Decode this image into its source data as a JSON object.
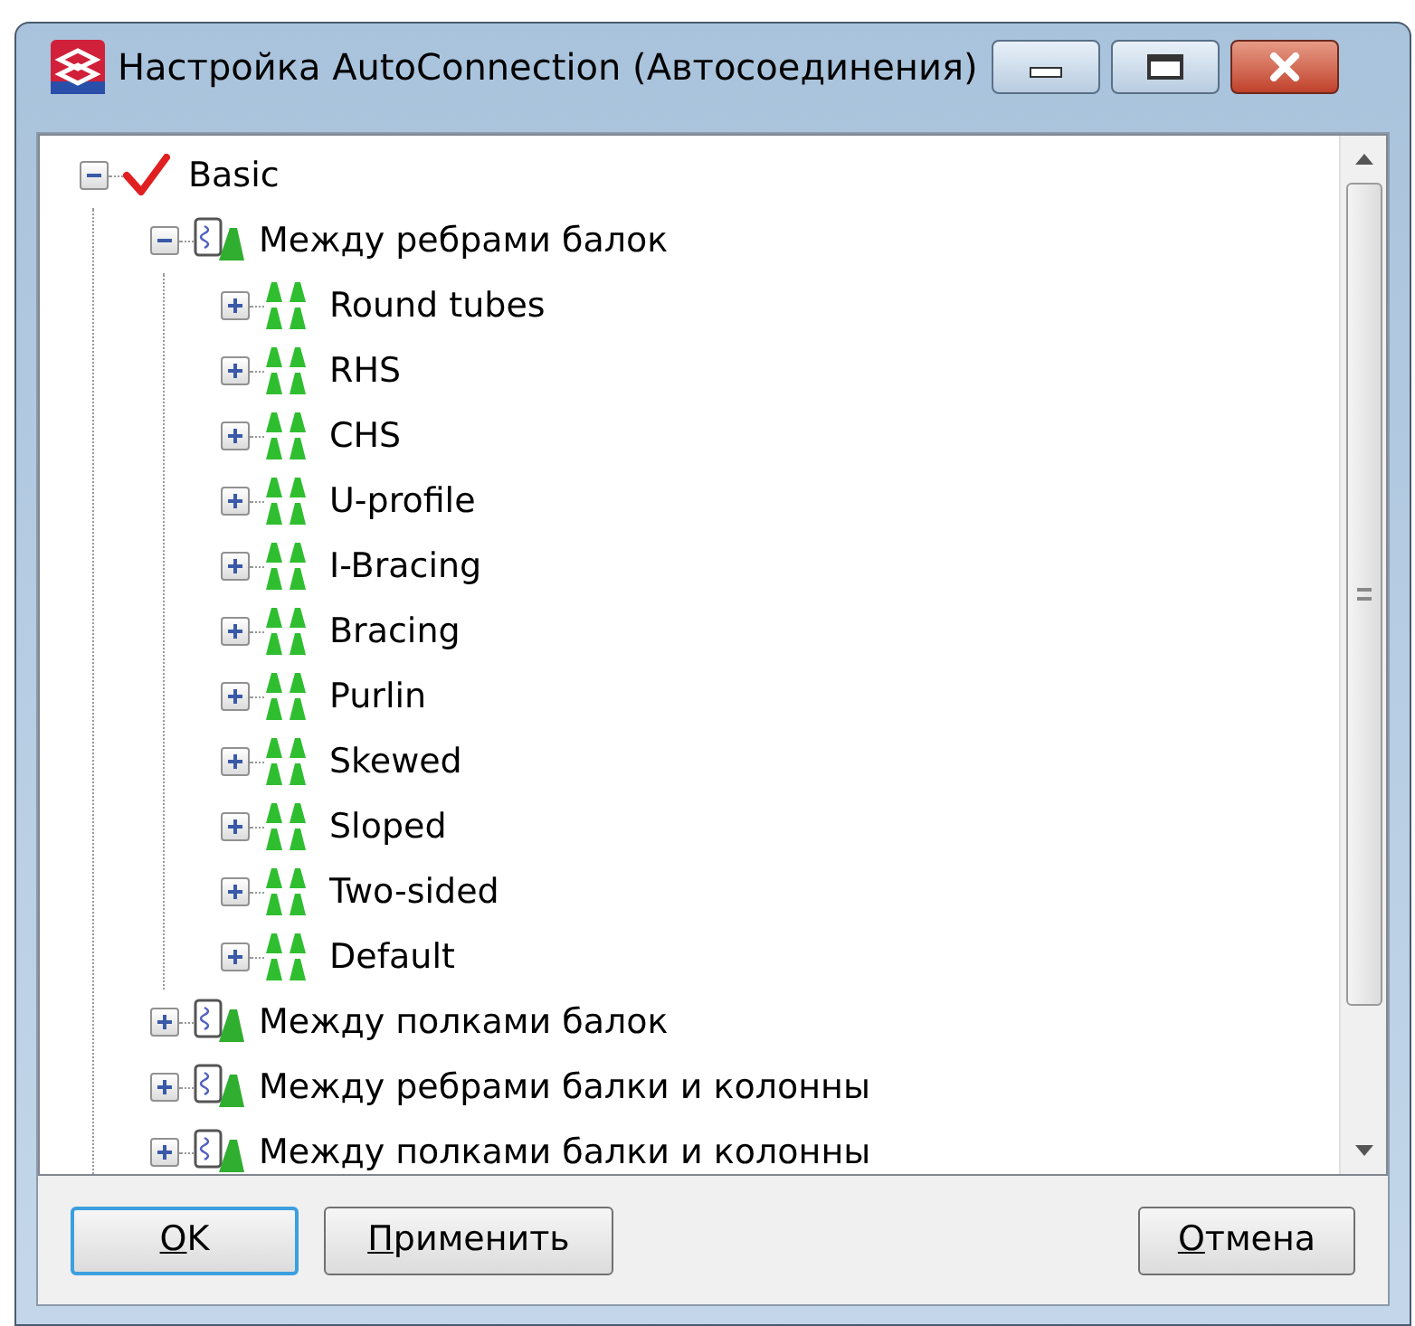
{
  "window": {
    "title": "Настройка AutoConnection (Автосоединения)"
  },
  "tree": [
    {
      "label": "Basic",
      "kind": "check",
      "expanded": true,
      "children": [
        {
          "label": "Между ребрами балок",
          "kind": "group",
          "expanded": true,
          "children": [
            {
              "label": "Round tubes",
              "kind": "item",
              "expanded": false
            },
            {
              "label": "RHS",
              "kind": "item",
              "expanded": false
            },
            {
              "label": "CHS",
              "kind": "item",
              "expanded": false
            },
            {
              "label": "U-profile",
              "kind": "item",
              "expanded": false
            },
            {
              "label": "I-Bracing",
              "kind": "item",
              "expanded": false
            },
            {
              "label": "Bracing",
              "kind": "item",
              "expanded": false
            },
            {
              "label": "Purlin",
              "kind": "item",
              "expanded": false
            },
            {
              "label": "Skewed",
              "kind": "item",
              "expanded": false
            },
            {
              "label": "Sloped",
              "kind": "item",
              "expanded": false
            },
            {
              "label": "Two-sided",
              "kind": "item",
              "expanded": false
            },
            {
              "label": "Default",
              "kind": "item",
              "expanded": false
            }
          ]
        },
        {
          "label": "Между полками балок",
          "kind": "group",
          "expanded": false
        },
        {
          "label": "Между ребрами балки и колонны",
          "kind": "group",
          "expanded": false
        },
        {
          "label": "Между полками балки и колонны",
          "kind": "group",
          "expanded": false
        }
      ]
    }
  ],
  "buttons": [
    {
      "label": "OK",
      "default": true,
      "mnemonic_underlined": true
    },
    {
      "label": "Применить",
      "default": false,
      "mnemonic_underlined": true
    },
    {
      "label": "Отмена",
      "default": false,
      "mnemonic_underlined": true
    }
  ]
}
